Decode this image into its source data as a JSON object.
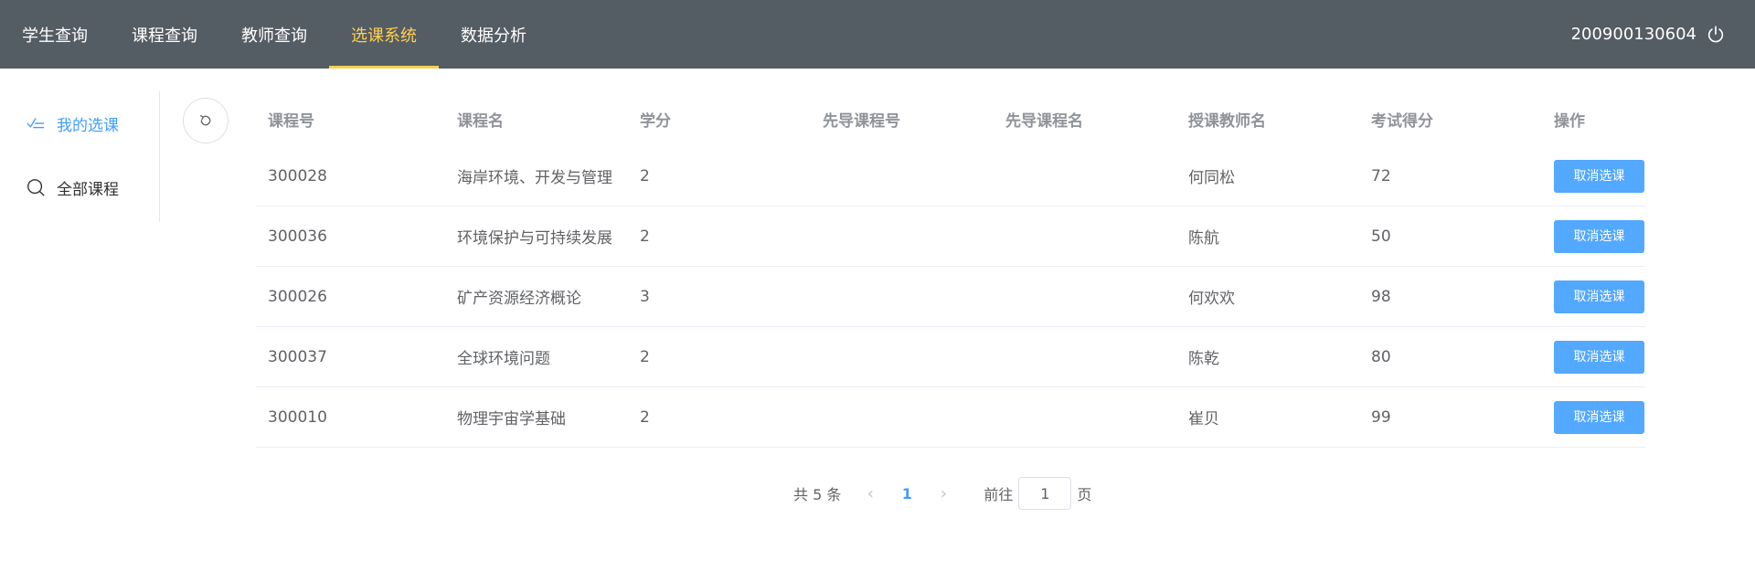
{
  "nav": {
    "items": [
      {
        "label": "学生查询"
      },
      {
        "label": "课程查询"
      },
      {
        "label": "教师查询"
      },
      {
        "label": "选课系统"
      },
      {
        "label": "数据分析"
      }
    ],
    "active_index": 3,
    "user_id": "200900130604"
  },
  "sidebar": {
    "items": [
      {
        "label": "我的选课",
        "icon": "checklist-icon"
      },
      {
        "label": "全部课程",
        "icon": "search-icon"
      }
    ],
    "active_index": 0
  },
  "table": {
    "headers": [
      "课程号",
      "课程名",
      "学分",
      "先导课程号",
      "先导课程名",
      "授课教师名",
      "考试得分",
      "操作"
    ],
    "rows": [
      {
        "id": "300028",
        "name": "海岸环境、开发与管理",
        "credit": "2",
        "pre_id": "",
        "pre_name": "",
        "teacher": "何同松",
        "score": "72",
        "action": "取消选课"
      },
      {
        "id": "300036",
        "name": "环境保护与可持续发展",
        "credit": "2",
        "pre_id": "",
        "pre_name": "",
        "teacher": "陈航",
        "score": "50",
        "action": "取消选课"
      },
      {
        "id": "300026",
        "name": "矿产资源经济概论",
        "credit": "3",
        "pre_id": "",
        "pre_name": "",
        "teacher": "何欢欢",
        "score": "98",
        "action": "取消选课"
      },
      {
        "id": "300037",
        "name": "全球环境问题",
        "credit": "2",
        "pre_id": "",
        "pre_name": "",
        "teacher": "陈乾",
        "score": "80",
        "action": "取消选课"
      },
      {
        "id": "300010",
        "name": "物理宇宙学基础",
        "credit": "2",
        "pre_id": "",
        "pre_name": "",
        "teacher": "崔贝",
        "score": "99",
        "action": "取消选课"
      }
    ]
  },
  "pager": {
    "total_text": "共 5 条",
    "current_page": "1",
    "goto_prefix": "前往",
    "goto_value": "1",
    "goto_suffix": "页"
  },
  "colors": {
    "topbar": "#545c64",
    "nav_active": "#ffd04b",
    "accent": "#409eff",
    "button": "#53a8ff"
  }
}
